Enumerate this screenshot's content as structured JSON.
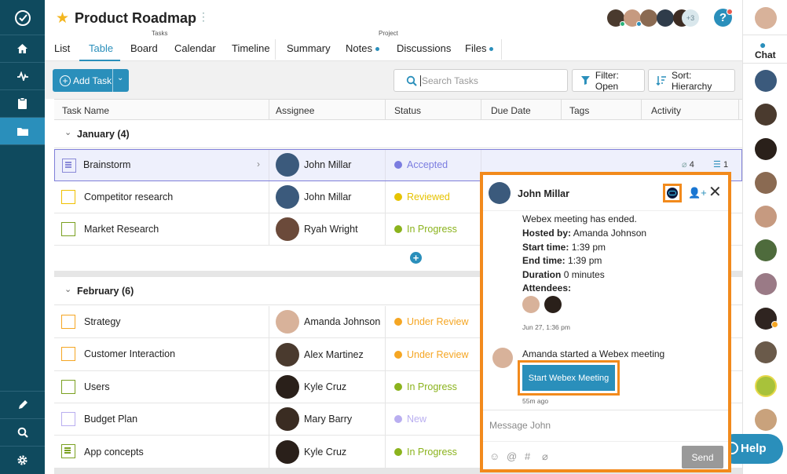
{
  "app": {
    "title": "Product Roadmap",
    "collaborators_overflow": "+3"
  },
  "leftnav": {
    "items": [
      "home-icon",
      "activity-icon",
      "clipboard-icon",
      "folder-icon"
    ],
    "bottom": [
      "pencil-icon",
      "search-icon",
      "gear-icon"
    ]
  },
  "tabs": [
    {
      "label": "List"
    },
    {
      "label": "Table",
      "active": true,
      "group": "Tasks"
    },
    {
      "label": "Board"
    },
    {
      "label": "Calendar"
    },
    {
      "label": "Timeline"
    },
    {
      "label": "Summary"
    },
    {
      "label": "Notes",
      "dot": true
    },
    {
      "label": "Discussions",
      "group": "Project"
    },
    {
      "label": "Files",
      "dot": true
    }
  ],
  "tab_groups": {
    "tasks": "Tasks",
    "project": "Project"
  },
  "toolbar": {
    "add_task": "Add Task",
    "search_placeholder": "Search Tasks",
    "filter": "Filter: Open",
    "sort": "Sort: Hierarchy"
  },
  "columns": [
    "Task Name",
    "Assignee",
    "Status",
    "Due Date",
    "Tags",
    "Activity"
  ],
  "groups": [
    {
      "label": "January (4)"
    },
    {
      "label": "February (6)"
    }
  ],
  "rows_jan": [
    {
      "name": "Brainstorm",
      "assignee": "John Millar",
      "status": "Accepted",
      "status_color": "#7b7de0",
      "box_color": "#8a8ad8",
      "attachments": "4",
      "subtasks": "1"
    },
    {
      "name": "Competitor research",
      "assignee": "John Millar",
      "status": "Reviewed",
      "status_color": "#e6c300",
      "box_color": "#f0c000"
    },
    {
      "name": "Market Research",
      "assignee": "Ryah Wright",
      "status": "In Progress",
      "status_color": "#8bb31d",
      "box_color": "#7aa020"
    }
  ],
  "rows_feb": [
    {
      "name": "Strategy",
      "assignee": "Amanda Johnson",
      "status": "Under Review",
      "status_color": "#f5a623",
      "box_color": "#f5a623"
    },
    {
      "name": "Customer Interaction",
      "assignee": "Alex Martinez",
      "status": "Under Review",
      "status_color": "#f5a623",
      "box_color": "#f5a623"
    },
    {
      "name": "Users",
      "assignee": "Kyle Cruz",
      "status": "In Progress",
      "status_color": "#8bb31d",
      "box_color": "#7aa020"
    },
    {
      "name": "Budget Plan",
      "assignee": "Mary Barry",
      "status": "New",
      "status_color": "#b9aef0",
      "box_color": "#b9aef0"
    },
    {
      "name": "App concepts",
      "assignee": "Kyle Cruz",
      "status": "In Progress",
      "status_color": "#8bb31d",
      "box_color": "#7aa020"
    }
  ],
  "chat": {
    "contact": "John Millar",
    "msg1_line1": "Webex meeting has ended.",
    "hosted_by_label": "Hosted by:",
    "hosted_by": "Amanda Johnson",
    "start_label": "Start time:",
    "start": "1:39 pm",
    "end_label": "End time:",
    "end": "1:39 pm",
    "duration_label": "Duration",
    "duration": "0 minutes",
    "attendees_label": "Attendees:",
    "msg1_time": "Jun 27, 1:36 pm",
    "msg2_text": "Amanda started a Webex meeting",
    "msg2_button": "Start Webex Meeting",
    "msg2_time": "55m ago",
    "input_placeholder": "Message John",
    "send": "Send"
  },
  "rightbar": {
    "chat_label": "Chat"
  },
  "help": {
    "label": "Help"
  },
  "colors": {
    "accent": "#2a8fbb",
    "nav": "#0f4a5e",
    "highlight": "#f28a1c"
  }
}
